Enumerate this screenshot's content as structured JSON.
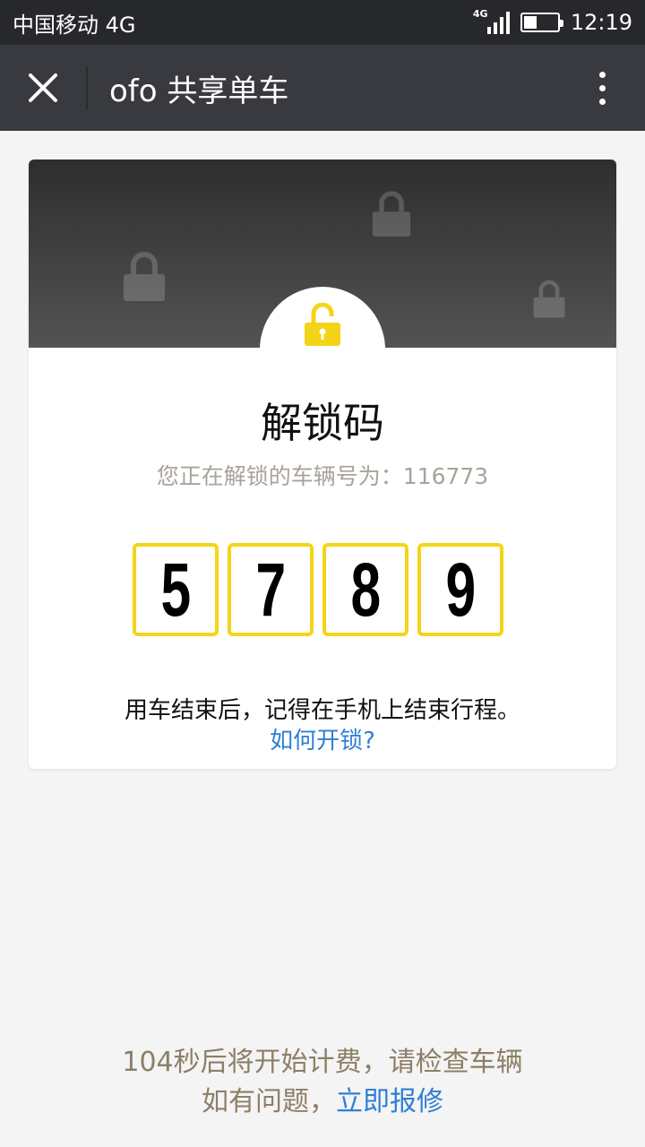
{
  "status_bar": {
    "carrier": "中国移动 4G",
    "network_badge": "4G",
    "time": "12:19",
    "battery_level": 0.4
  },
  "nav": {
    "title": "ofo 共享单车",
    "close_icon": "close-icon",
    "more_icon": "more-vertical-icon"
  },
  "card": {
    "title": "解锁码",
    "subtitle": "您正在解锁的车辆号为：116773",
    "code_digits": [
      "5",
      "7",
      "8",
      "9"
    ],
    "note": "用车结束后，记得在手机上结束行程。",
    "help_link": "如何开锁?",
    "lock_icon": "unlocked-padlock-icon"
  },
  "footer": {
    "countdown_text": "104秒后将开始计费，请检查车辆",
    "problem_prefix": "如有问题，",
    "repair_link": "立即报修"
  },
  "colors": {
    "accent_yellow": "#f5d418",
    "link_blue": "#2f7fd6",
    "footer_text": "#8d7f66",
    "nav_bg": "#393a3f"
  }
}
